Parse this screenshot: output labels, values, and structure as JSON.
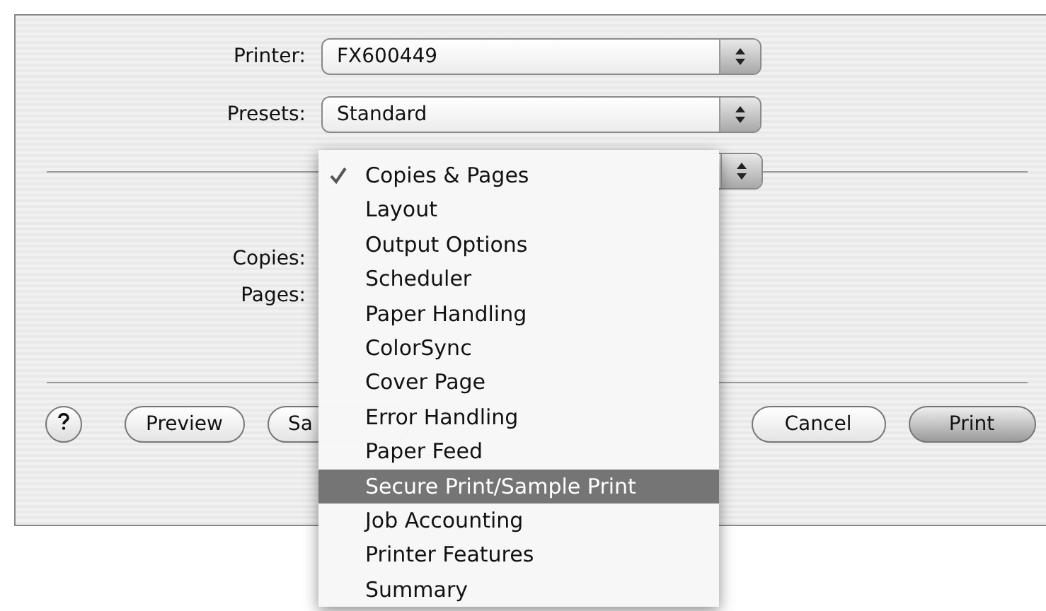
{
  "printer": {
    "label": "Printer:",
    "value": "FX600449"
  },
  "presets": {
    "label": "Presets:",
    "value": "Standard"
  },
  "panel_menu": {
    "items": [
      {
        "label": "Copies & Pages",
        "checked": true,
        "selected": false
      },
      {
        "label": "Layout",
        "checked": false,
        "selected": false
      },
      {
        "label": "Output Options",
        "checked": false,
        "selected": false
      },
      {
        "label": "Scheduler",
        "checked": false,
        "selected": false
      },
      {
        "label": "Paper Handling",
        "checked": false,
        "selected": false
      },
      {
        "label": "ColorSync",
        "checked": false,
        "selected": false
      },
      {
        "label": "Cover Page",
        "checked": false,
        "selected": false
      },
      {
        "label": "Error Handling",
        "checked": false,
        "selected": false
      },
      {
        "label": "Paper Feed",
        "checked": false,
        "selected": false
      },
      {
        "label": "Secure Print/Sample Print",
        "checked": false,
        "selected": true
      },
      {
        "label": "Job Accounting",
        "checked": false,
        "selected": false
      },
      {
        "label": "Printer Features",
        "checked": false,
        "selected": false
      },
      {
        "label": "Summary",
        "checked": false,
        "selected": false
      }
    ]
  },
  "copies": {
    "label": "Copies:"
  },
  "pages": {
    "label": "Pages:"
  },
  "buttons": [
    {
      "label": "Preview",
      "kind": "left"
    },
    {
      "label": "Sa",
      "kind": "left"
    },
    {
      "label": "Cancel",
      "kind": "right"
    },
    {
      "label": "Print",
      "kind": "default"
    }
  ]
}
